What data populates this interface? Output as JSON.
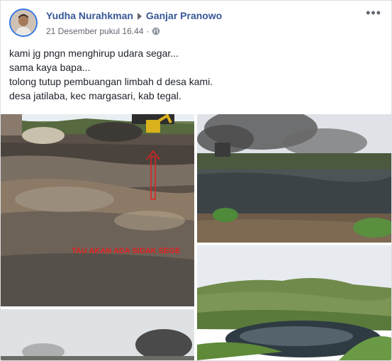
{
  "post": {
    "author": "Yudha Nurahkman",
    "target": "Ganjar Pranowo",
    "timestamp": "21 Desember pukul 16.44",
    "privacy_icon": "globe-icon",
    "lines": [
      "kami jg pngn menghirup udara segar...",
      "sama kaya bapa...",
      "tolong tutup pembuangan limbah d desa kami.",
      "desa jatilaba, kec margasari, kab tegal."
    ],
    "photo1_overlay": "TAU AKAN ADA SIDAK  SEGE"
  },
  "icons": {
    "more": "more-options-icon",
    "arrow": "triangle-right-icon"
  },
  "colors": {
    "link": "#385898",
    "text": "#1d2129",
    "meta": "#616770",
    "overlay": "#e02020"
  }
}
